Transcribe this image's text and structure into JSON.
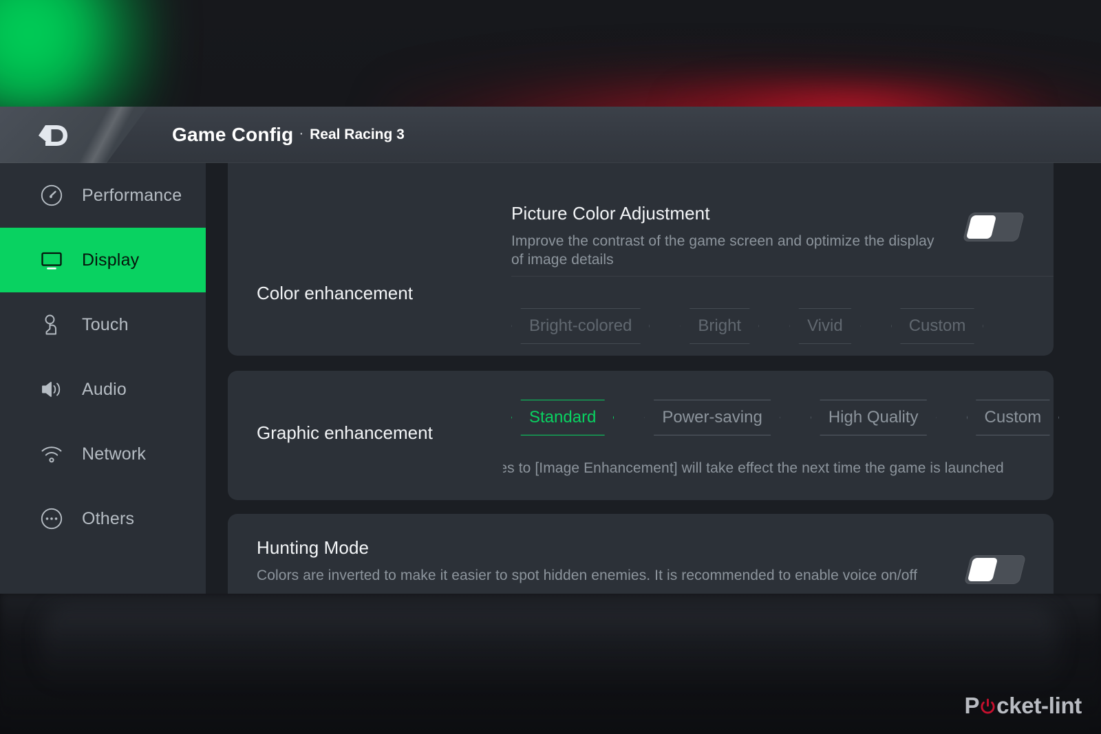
{
  "titlebar": {
    "logo_icon": "gamespace-d-logo-icon",
    "title": "Game Config",
    "separator": "·",
    "subtitle": "Real Racing 3"
  },
  "sidebar": {
    "items": [
      {
        "label": "Performance",
        "icon": "speedometer-icon",
        "active": false
      },
      {
        "label": "Display",
        "icon": "monitor-icon",
        "active": true
      },
      {
        "label": "Touch",
        "icon": "touch-hand-icon",
        "active": false
      },
      {
        "label": "Audio",
        "icon": "speaker-icon",
        "active": false
      },
      {
        "label": "Network",
        "icon": "wifi-icon",
        "active": false
      },
      {
        "label": "Others",
        "icon": "ellipsis-circle-icon",
        "active": false
      }
    ]
  },
  "content": {
    "color_enhancement": {
      "label": "Color enhancement",
      "row_title": "Picture Color Adjustment",
      "row_desc": "Improve the contrast of the game screen and optimize the display of image details",
      "toggle_state": "off",
      "chips": [
        {
          "label": "Bright-colored",
          "state": "disabled"
        },
        {
          "label": "Bright",
          "state": "disabled"
        },
        {
          "label": "Vivid",
          "state": "disabled"
        },
        {
          "label": "Custom",
          "state": "disabled"
        }
      ]
    },
    "graphic_enhancement": {
      "label": "Graphic enhancement",
      "chips": [
        {
          "label": "Standard",
          "state": "selected"
        },
        {
          "label": "Power-saving",
          "state": "normal"
        },
        {
          "label": "High Quality",
          "state": "normal"
        },
        {
          "label": "Custom",
          "state": "normal"
        }
      ],
      "hint": "Changes to [Image Enhancement] will take effect the next time the game is launched"
    },
    "hunting_mode": {
      "row_title": "Hunting Mode",
      "row_desc": "Colors are inverted to make it easier to spot hidden enemies. It is recommended to enable voice on/off",
      "toggle_state": "off"
    }
  },
  "watermark": {
    "part1": "P",
    "power_icon": "power-button-icon",
    "part2": "cket-lint"
  },
  "colors": {
    "accent_green": "#09d261",
    "panel_bg": "#2c3138",
    "content_bg": "#1b1e23",
    "sidebar_bg": "#2a2f36",
    "titlebar_bg": "#353a42",
    "watermark_red": "#c8102e"
  }
}
